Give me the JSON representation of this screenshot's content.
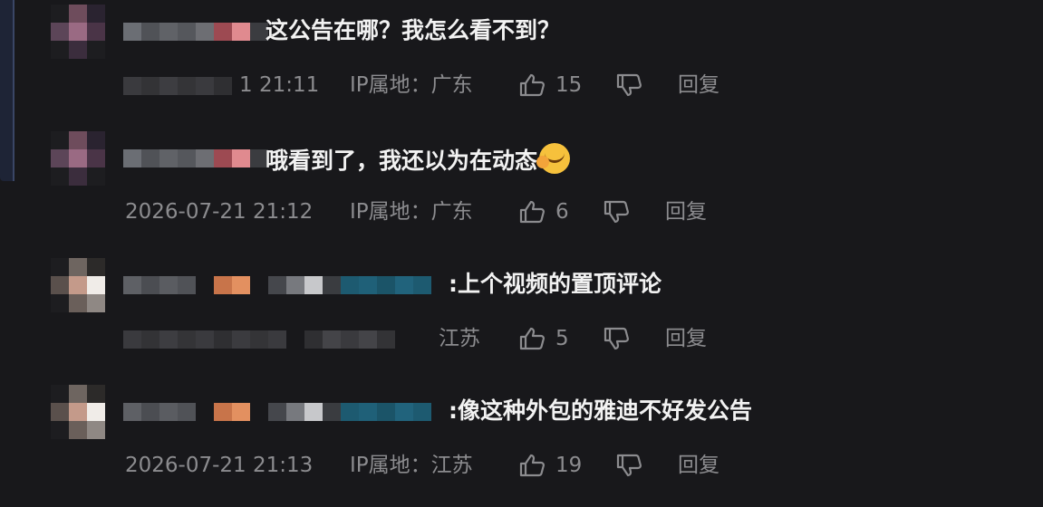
{
  "comments": [
    {
      "text": "这公告在哪？我怎么看不到？",
      "timestamp": "1 21:11",
      "location_label": "IP属地：广东",
      "likes": "15",
      "reply_label": "回复"
    },
    {
      "text": "哦看到了，我还以为在动态",
      "timestamp": "2026-07-21 21:12",
      "location_label": "IP属地：广东",
      "likes": "6",
      "reply_label": "回复"
    },
    {
      "text": ":上个视频的置顶评论",
      "timestamp": "",
      "location_label": "江苏",
      "likes": "5",
      "reply_label": "回复"
    },
    {
      "text": ":像这种外包的雅迪不好发公告",
      "timestamp": "2026-07-21 21:13",
      "location_label": "IP属地：江苏",
      "likes": "19",
      "reply_label": "回复"
    }
  ],
  "icons": {
    "like": "thumbs-up-icon",
    "dislike": "thumbs-down-icon",
    "emoji": "facepalm-laugh-emoji-icon"
  },
  "colors": {
    "background": "#18181b",
    "comment_text": "#f2f2f2",
    "meta_text": "#8c8c8f"
  }
}
